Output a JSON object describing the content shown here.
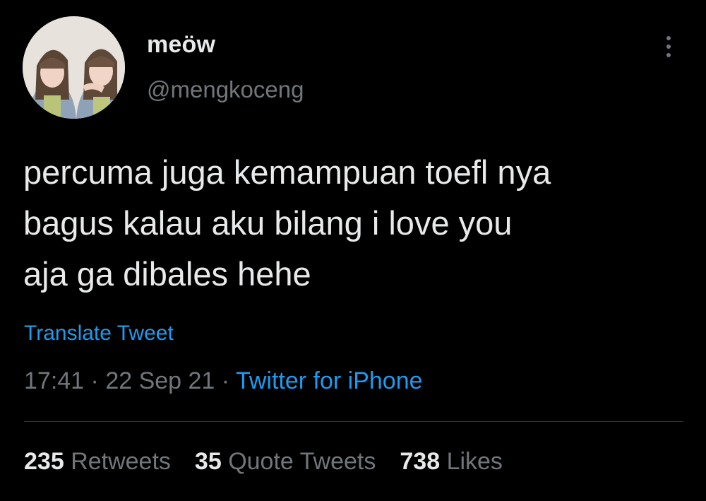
{
  "user": {
    "display_name": "meöw",
    "handle": "@mengkoceng",
    "avatar_icon": "profile-photo-avatar"
  },
  "tweet": {
    "text": "percuma juga kemampuan toefl nya\nbagus kalau aku bilang i love you\naja ga dibales hehe",
    "translate_label": "Translate Tweet",
    "time": "17:41",
    "date": "22 Sep 21",
    "separator": " · ",
    "source": "Twitter for iPhone"
  },
  "stats": {
    "retweets_count": "235",
    "retweets_label": "Retweets",
    "quotes_count": "35",
    "quotes_label": "Quote Tweets",
    "likes_count": "738",
    "likes_label": "Likes"
  },
  "colors": {
    "background": "#000000",
    "primary_text": "#e7e9ea",
    "secondary_text": "#71767b",
    "link": "#1d9bf0",
    "divider": "#2f3336"
  }
}
